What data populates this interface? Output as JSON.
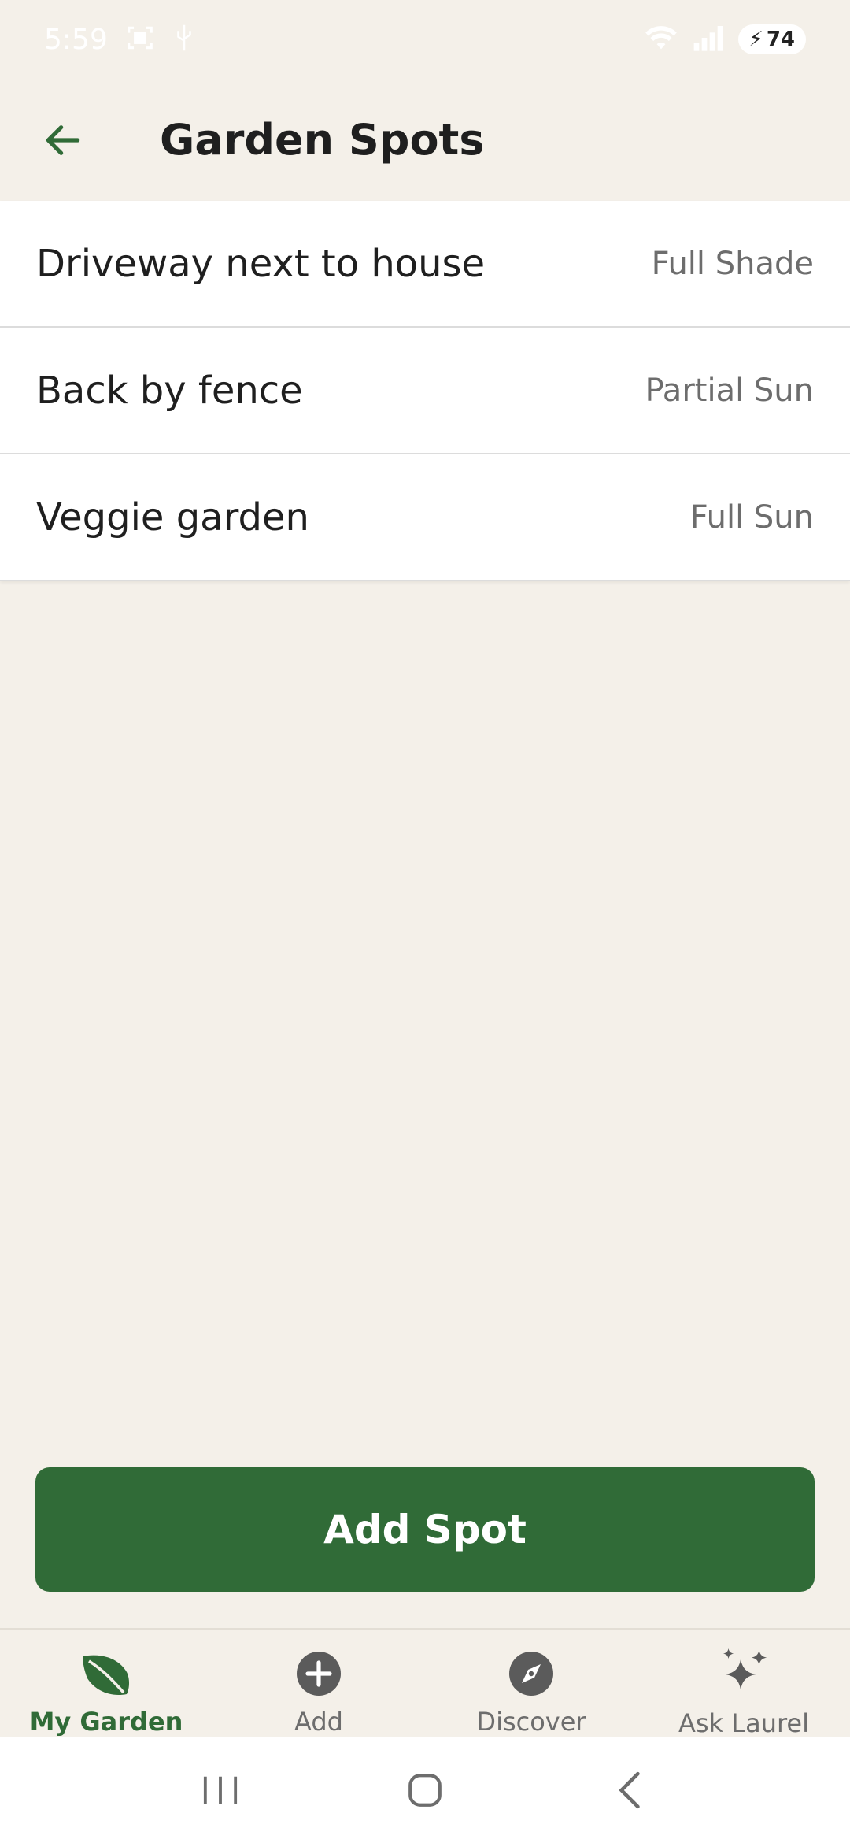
{
  "status_bar": {
    "time": "5:59",
    "battery": "74"
  },
  "header": {
    "title": "Garden Spots"
  },
  "spots": [
    {
      "name": "Driveway next to house",
      "sun": "Full Shade"
    },
    {
      "name": "Back by fence",
      "sun": "Partial Sun"
    },
    {
      "name": "Veggie garden",
      "sun": "Full Sun"
    }
  ],
  "add_button": {
    "label": "Add Spot"
  },
  "bottom_nav": {
    "items": [
      {
        "label": "My Garden",
        "icon": "leaf-icon",
        "active": true
      },
      {
        "label": "Add",
        "icon": "plus-circle-icon",
        "active": false
      },
      {
        "label": "Discover",
        "icon": "compass-icon",
        "active": false
      },
      {
        "label": "Ask Laurel",
        "icon": "sparkle-icon",
        "active": false
      }
    ]
  },
  "colors": {
    "brand_green": "#306b37",
    "background": "#f4f0e9",
    "muted_text": "#6d6d6d"
  }
}
